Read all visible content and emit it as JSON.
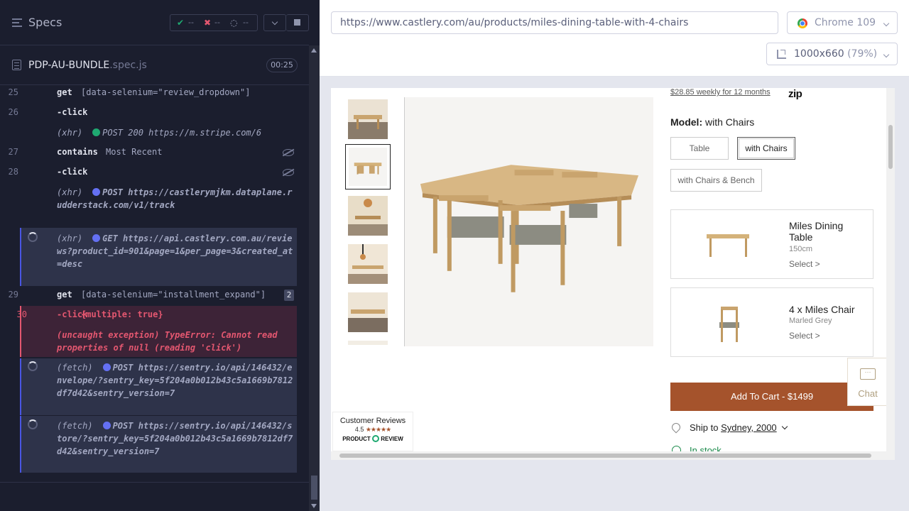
{
  "specs_panel": {
    "title": "Specs",
    "stats": {
      "passed_icon": "check-icon",
      "passed": "--",
      "failed_icon": "x-icon",
      "failed": "--",
      "pending_icon": "spinner-icon",
      "pending": "--"
    },
    "file": {
      "name": "PDP-AU-BUNDLE",
      "ext": ".spec.js",
      "timer": "00:25"
    }
  },
  "commands": [
    {
      "line": "25",
      "name": "get",
      "message": "[data-selenium=\"review_dropdown\"]"
    },
    {
      "line": "26",
      "name": "-click",
      "message": ""
    },
    {
      "type": "(xhr)",
      "method": "POST 200 https://m.stripe.com/6",
      "status": "green"
    },
    {
      "line": "27",
      "name": "contains",
      "message": "Most Recent",
      "icon": "eye-slash-icon"
    },
    {
      "line": "28",
      "name": "-click",
      "message": "",
      "icon": "eye-slash-icon"
    },
    {
      "type": "(xhr)",
      "method": "POST",
      "url": "https://castlerymjkm.dataplane.rudderstack.com/v1/track",
      "status": "blue"
    },
    {
      "type": "(xhr)",
      "method": "GET",
      "url": "https://api.castlery.com.au/reviews?product_id=901&page=1&per_page=3&created_at=desc",
      "status": "blue",
      "pending": true
    },
    {
      "line": "29",
      "name": "get",
      "message": "[data-selenium=\"installment_expand\"]",
      "count": "2"
    },
    {
      "line": "30",
      "name": "-click",
      "message": "{multiple: true}",
      "error": true
    },
    {
      "error_text": "(uncaught exception)  TypeError: Cannot read properties of null (reading 'click')"
    },
    {
      "type": "(fetch)",
      "method": "POST",
      "url": "https://sentry.io/api/146432/envelope/?sentry_key=5f204a0b012b43c5a1669b7812df7d42&sentry_version=7",
      "status": "blue",
      "pending": true
    },
    {
      "type": "(fetch)",
      "method": "POST",
      "url": "https://sentry.io/api/146432/store/?sentry_key=5f204a0b012b43c5a1669b7812df7d42&sentry_version=7",
      "status": "blue",
      "pending": true
    }
  ],
  "browser_bar": {
    "url": "https://www.castlery.com/au/products/miles-dining-table-with-4-chairs",
    "browser": "Chrome 109",
    "viewport": "1000x660",
    "scale": "(79%)"
  },
  "page": {
    "zip_text": "$28.85 weekly for 12 months",
    "zip_logo": "zip",
    "model_label": "Model:",
    "model_value": "with Chairs",
    "options": [
      "Table",
      "with Chairs",
      "with Chairs & Bench"
    ],
    "selected_option": "with Chairs",
    "items": [
      {
        "title": "Miles Dining Table",
        "sub": "150cm",
        "select": "Select >"
      },
      {
        "title": "4 x Miles Chair",
        "sub": "Marled Grey",
        "select": "Select >"
      }
    ],
    "add_to_cart": "Add To Cart - $1499",
    "chat": "Chat",
    "ship_prefix": "Ship to",
    "ship_location": "Sydney, 2000",
    "stock": "In stock",
    "reviews": {
      "title": "Customer Reviews",
      "rating": "4.5",
      "stars": "★★★★★",
      "brand": "PRODUCT",
      "brand2": "REVIEW"
    }
  },
  "colors": {
    "accent_blue": "#4956e3",
    "error_red": "#e45770",
    "pass_green": "#1fa971",
    "cart_brown": "#a5532c"
  }
}
